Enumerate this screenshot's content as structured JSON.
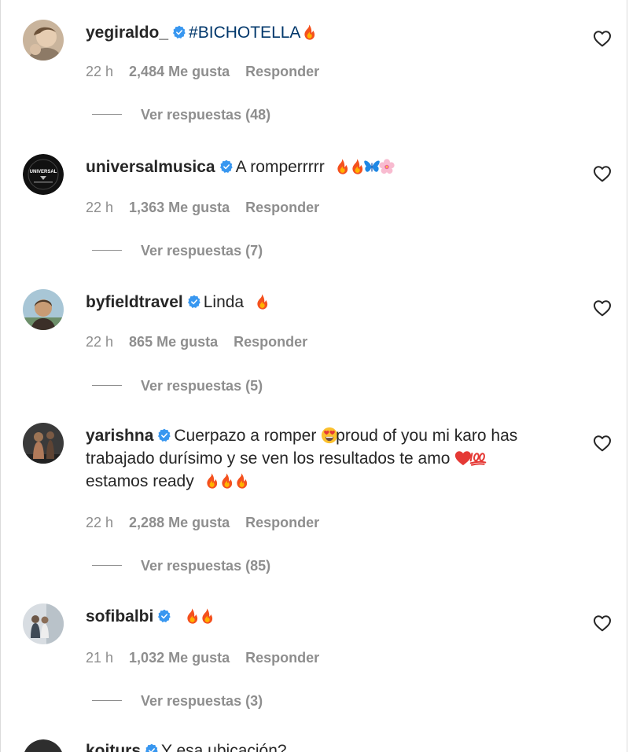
{
  "comments": [
    {
      "username": "yegiraldo_",
      "hashtag": "#BICHOTELLA",
      "text": "",
      "emoji_after": [
        "fire-emoji"
      ],
      "time": "22 h",
      "likes": "2,484 Me gusta",
      "reply_label": "Responder",
      "view_replies": "Ver respuestas (48)"
    },
    {
      "username": "universalmusica",
      "text": "A romperrrrr",
      "emoji_after": [
        "fire-emoji",
        "fire-emoji",
        "butterfly-emoji",
        "blossom-emoji"
      ],
      "avatar_text": "UNIVERSAL",
      "time": "22 h",
      "likes": "1,363 Me gusta",
      "reply_label": "Responder",
      "view_replies": "Ver respuestas (7)"
    },
    {
      "username": "byfieldtravel",
      "text": "Linda",
      "emoji_after": [
        "fire-emoji"
      ],
      "time": "22 h",
      "likes": "865 Me gusta",
      "reply_label": "Responder",
      "view_replies": "Ver respuestas (5)"
    },
    {
      "username": "yarishna",
      "text_part1": "Cuerpazo a romper",
      "text_part2": "proud of you mi karo has trabajado durísimo y se ven los resultados te amo",
      "text_part3": "estamos ready",
      "time": "22 h",
      "likes": "2,288 Me gusta",
      "reply_label": "Responder",
      "view_replies": "Ver respuestas (85)"
    },
    {
      "username": "sofibalbi",
      "text": "",
      "emoji_after": [
        "fire-emoji",
        "fire-emoji"
      ],
      "time": "21 h",
      "likes": "1,032 Me gusta",
      "reply_label": "Responder",
      "view_replies": "Ver respuestas (3)"
    },
    {
      "username": "koiturs",
      "text": "Y esa ubicación?"
    }
  ],
  "colors": {
    "text": "#262626",
    "secondary": "#8e8e8e",
    "verified": "#3897f0",
    "hashtag": "#00376b",
    "border": "#dbdbdb"
  }
}
